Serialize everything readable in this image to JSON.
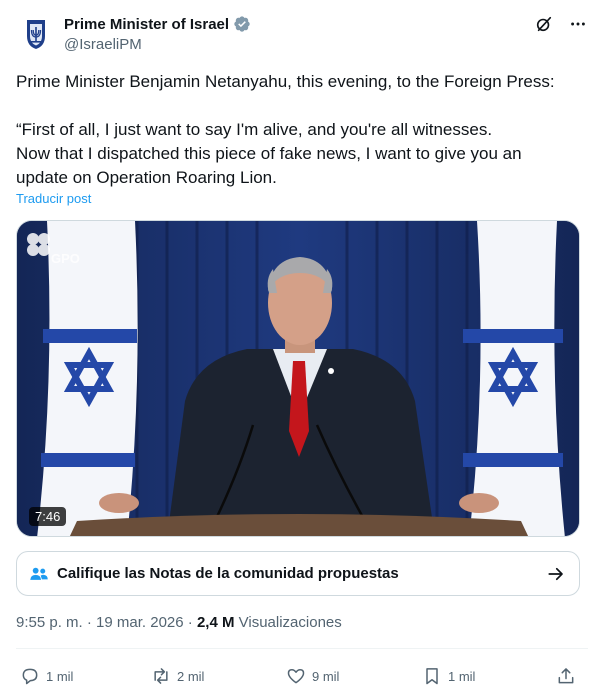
{
  "author": {
    "display_name": "Prime Minister of Israel",
    "handle": "@IsraeliPM",
    "verified": true,
    "avatar_icon": "israel-emblem-icon"
  },
  "header_actions": [
    {
      "icon": "grok-icon"
    },
    {
      "icon": "more-icon"
    }
  ],
  "tweet": {
    "paragraph_1": "Prime Minister Benjamin Netanyahu, this evening, to the Foreign Press:",
    "paragraph_2_line_1": "“First of all, I just want to say I'm alive, and you're all witnesses.",
    "paragraph_2_line_2": "Now that I dispatched this piece of fake news, I want to give you an",
    "paragraph_2_line_3": "update on Operation Roaring Lion."
  },
  "translate_label": "Traducir post",
  "media": {
    "watermark": "GPO",
    "duration": "7:46"
  },
  "community_notes": {
    "label": "Califique las Notas de la comunidad propuestas",
    "icon": "people-icon",
    "arrow_icon": "arrow-right-icon"
  },
  "meta": {
    "time": "9:55 p. m.",
    "separator": " · ",
    "date": "19 mar. 2026",
    "views_count": "2,4 M",
    "views_label": "Visualizaciones"
  },
  "actions": [
    {
      "icon": "reply-icon",
      "count": "1 mil"
    },
    {
      "icon": "repost-icon",
      "count": "2 mil"
    },
    {
      "icon": "like-icon",
      "count": "9 mil"
    },
    {
      "icon": "bookmark-icon",
      "count": "1 mil"
    },
    {
      "icon": "share-icon",
      "count": ""
    }
  ],
  "colors": {
    "text": "#0f1419",
    "secondary": "#536471",
    "link": "#1d9bf0",
    "verified": "#829aab",
    "border": "#cfd9de"
  }
}
